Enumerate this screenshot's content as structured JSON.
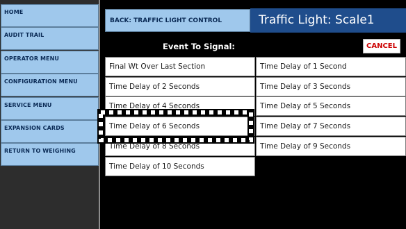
{
  "sidebar": {
    "items": [
      {
        "label": "HOME"
      },
      {
        "label": "AUDIT TRAIL"
      },
      {
        "label": "OPERATOR MENU"
      },
      {
        "label": "CONFIGURATION MENU"
      },
      {
        "label": "SERVICE MENU"
      },
      {
        "label": "EXPANSION CARDS"
      },
      {
        "label": "RETURN TO WEIGHING"
      }
    ]
  },
  "header": {
    "back_label": "BACK: TRAFFIC LIGHT CONTROL",
    "title": "Traffic Light: Scale1"
  },
  "event": {
    "label": "Event To Signal:",
    "cancel_label": "CANCEL"
  },
  "options": {
    "left": [
      "Final Wt Over Last Section",
      "Time Delay of 2 Seconds",
      "Time Delay of 4 Seconds",
      "Time Delay of 6 Seconds",
      "Time Delay of 8 Seconds",
      "Time Delay of 10 Seconds"
    ],
    "right": [
      "Time Delay of 1 Second",
      "Time Delay of 3 Seconds",
      "Time Delay of 5 Seconds",
      "Time Delay of 7 Seconds",
      "Time Delay of 9 Seconds"
    ]
  },
  "colors": {
    "nav_bg": "#9fc8ec",
    "title_bg": "#1f4d8c",
    "cancel_text": "#cc0000",
    "main_bg": "#000000"
  }
}
